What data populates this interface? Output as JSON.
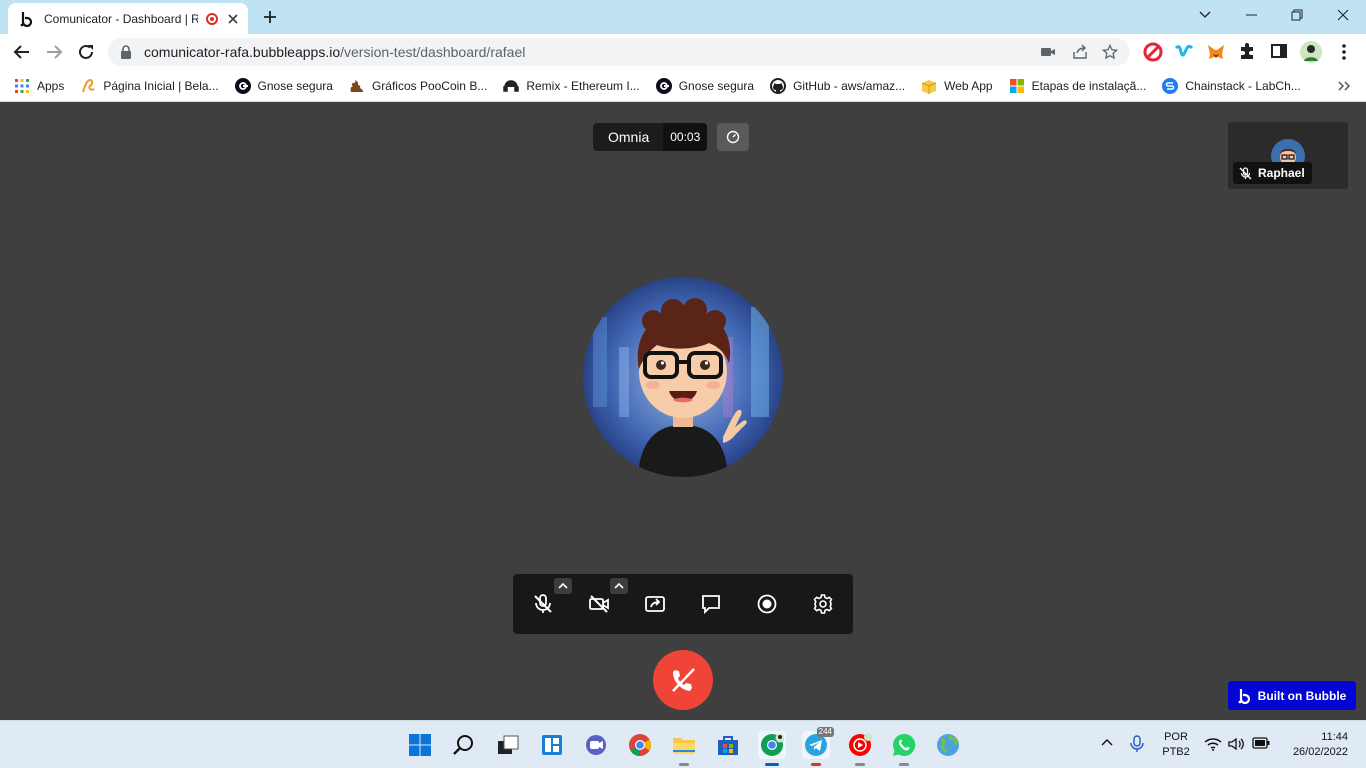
{
  "browser": {
    "tab_title": "Comunicator - Dashboard | R",
    "url_host": "comunicator-rafa.bubbleapps.io",
    "url_path": "/version-test/dashboard/rafael",
    "bookmarks": [
      {
        "label": "Apps",
        "icon": "apps-grid-icon"
      },
      {
        "label": "Página Inicial | Bela...",
        "icon": "bela-icon"
      },
      {
        "label": "Gnose segura",
        "icon": "gnose-icon"
      },
      {
        "label": "Gráficos PooCoin B...",
        "icon": "poocoin-icon"
      },
      {
        "label": "Remix - Ethereum I...",
        "icon": "remix-icon"
      },
      {
        "label": "Gnose segura",
        "icon": "gnose-icon"
      },
      {
        "label": "GitHub - aws/amaz...",
        "icon": "github-icon"
      },
      {
        "label": "Web App",
        "icon": "package-icon"
      },
      {
        "label": "Etapas de instalaçã...",
        "icon": "windows-icon"
      },
      {
        "label": "Chainstack - LabCh...",
        "icon": "chainstack-icon"
      }
    ]
  },
  "call": {
    "room_name": "Omnia",
    "timer": "00:03",
    "participant_name": "Raphael",
    "badge": "Built on Bubble"
  },
  "taskbar": {
    "lang_line1": "POR",
    "lang_line2": "PTB2",
    "time": "11:44",
    "date": "26/02/2022",
    "telegram_badge": "244"
  },
  "colors": {
    "stage_bg": "#3f3f3f",
    "hangup": "#ef4437",
    "bubble_blue": "#0205d3",
    "tabbar": "#bfe3f2"
  }
}
